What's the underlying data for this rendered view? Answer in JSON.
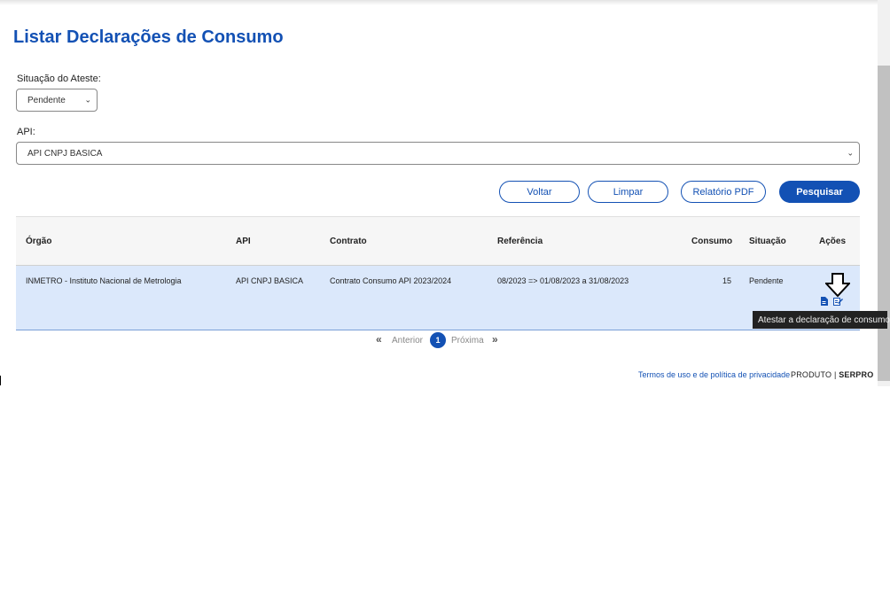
{
  "page": {
    "title": "Listar Declarações de Consumo"
  },
  "filters": {
    "situacao_label": "Situação do Ateste:",
    "situacao_value": "Pendente",
    "api_label": "API:",
    "api_value": "API CNPJ BASICA"
  },
  "buttons": {
    "voltar": "Voltar",
    "limpar": "Limpar",
    "relatorio": "Relatório PDF",
    "pesquisar": "Pesquisar"
  },
  "table": {
    "headers": [
      "Órgão",
      "API",
      "Contrato",
      "Referência",
      "Consumo",
      "Situação",
      "Ações"
    ],
    "rows": [
      {
        "orgao": "INMETRO - Instituto Nacional de Metrologia",
        "api": "API CNPJ BASICA",
        "contrato": "Contrato Consumo API 2023/2024",
        "referencia": "08/2023 => 01/08/2023 a 31/08/2023",
        "consumo": "15",
        "situacao": "Pendente"
      }
    ]
  },
  "tooltip": "Atestar a declaração de consumo.",
  "pagination": {
    "previous": "Anterior",
    "current": "1",
    "next": "Próxima"
  },
  "footer": {
    "terms": "Termos de uso e de política de privacidade",
    "produto": "PRODUTO",
    "brand": "SERPRO"
  },
  "icons": [
    "chevron-down-icon",
    "document-icon",
    "edit-icon",
    "arrow-down-icon",
    "double-chevron-left-icon",
    "double-chevron-right-icon"
  ],
  "colors": {
    "primary": "#1351b4",
    "row_highlight": "#dbe8fb",
    "tooltip_bg": "#222222"
  }
}
